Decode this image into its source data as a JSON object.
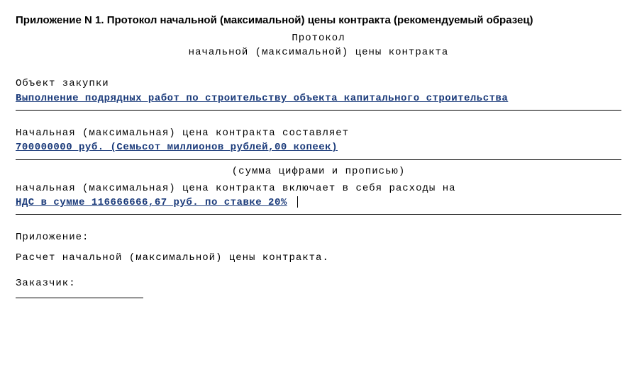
{
  "header": {
    "title": "Приложение N 1. Протокол начальной (максимальной) цены контракта (рекомендуемый образец)",
    "line1": "Протокол",
    "line2": "начальной  (максимальной)  цены контракта"
  },
  "object": {
    "label": "Объект закупки",
    "value": "Выполнение подрядных работ по строительству объекта капитального строительства"
  },
  "price": {
    "intro": "Начальная  (максимальная)  цена  контракта  составляет",
    "value": "700000000 руб. (Семьсот миллионов рублей,00 копеек)",
    "note": "(сумма цифрами и прописью)",
    "includes": "начальная  (максимальная)  цена  контракта  включает  в  себя  расходы  на",
    "vat": "НДС в сумме 116666666,67 руб. по ставке 20%"
  },
  "attachment": {
    "label": "Приложение:",
    "text": "Расчет начальной (максимальной) цены контракта."
  },
  "customer": {
    "label": "Заказчик:"
  }
}
